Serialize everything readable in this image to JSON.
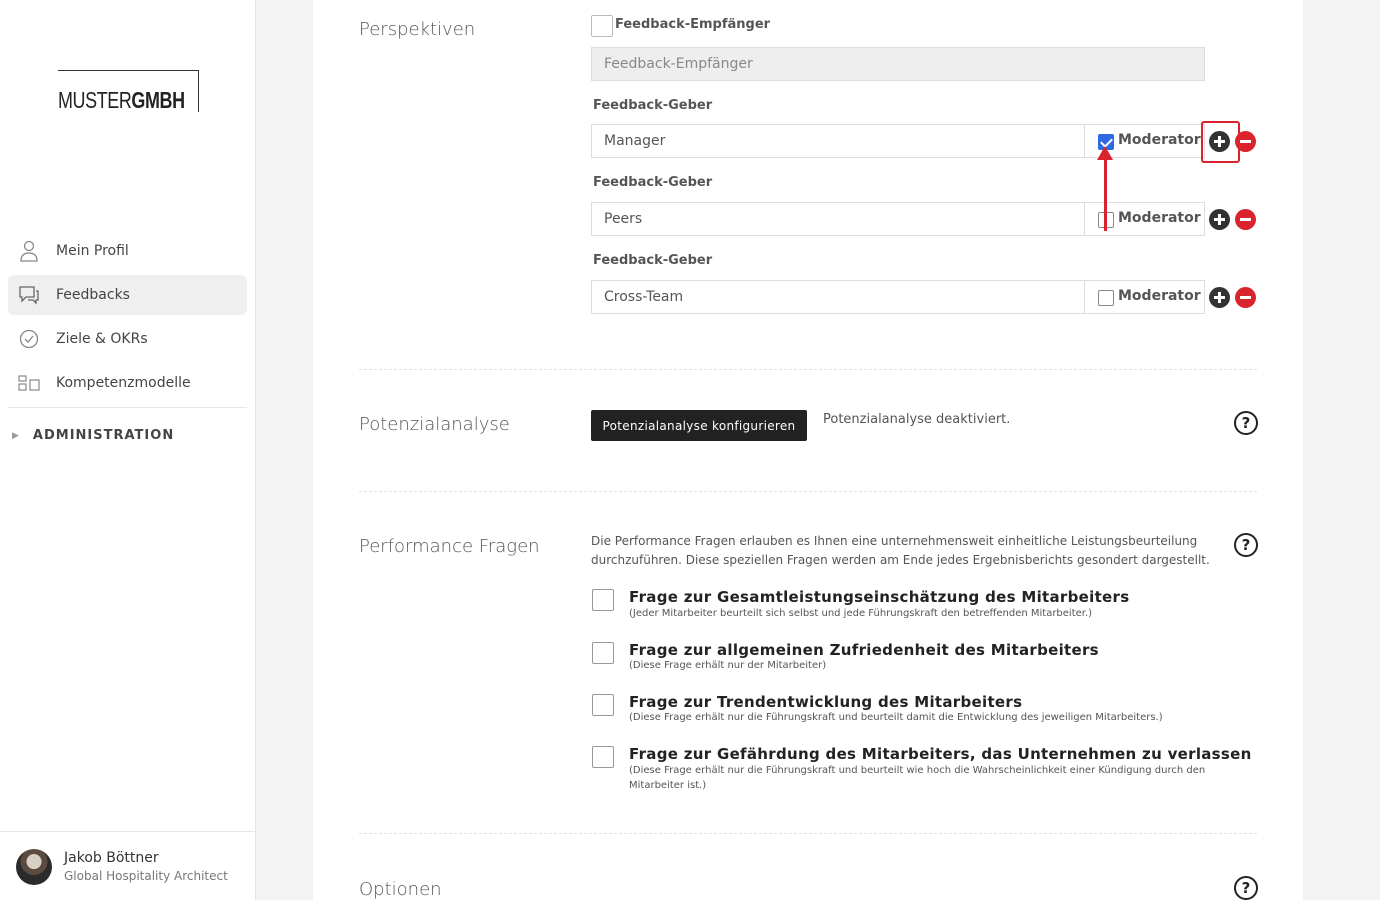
{
  "logo": {
    "part1": "MUSTER",
    "part2": "GMBH"
  },
  "nav": {
    "items": [
      {
        "label": "Mein Profil",
        "icon": "user-icon"
      },
      {
        "label": "Feedbacks",
        "icon": "chat-icon",
        "active": true
      },
      {
        "label": "Ziele & OKRs",
        "icon": "check-circle-icon"
      },
      {
        "label": "Kompetenzmodelle",
        "icon": "blocks-icon"
      }
    ],
    "admin_label": "ADMINISTRATION"
  },
  "user": {
    "name": "Jakob Böttner",
    "role": "Global Hospitality Architect"
  },
  "perspektiven": {
    "title": "Perspektiven",
    "empfaenger_label": "Feedback-Empfänger",
    "empfaenger_value": "Feedback-Empfänger",
    "geber": [
      {
        "label": "Feedback-Geber",
        "value": "Manager",
        "moderator_label": "Moderator",
        "moderator_checked": true
      },
      {
        "label": "Feedback-Geber",
        "value": "Peers",
        "moderator_label": "Moderator",
        "moderator_checked": false
      },
      {
        "label": "Feedback-Geber",
        "value": "Cross-Team",
        "moderator_label": "Moderator",
        "moderator_checked": false
      }
    ]
  },
  "potenzialanalyse": {
    "title": "Potenzialanalyse",
    "button_label": "Potenzialanalyse konfigurieren",
    "status": "Potenzialanalyse deaktiviert."
  },
  "performance": {
    "title": "Performance Fragen",
    "description": "Die Performance Fragen erlauben es Ihnen eine unternehmensweit einheitliche Leistungsbeurteilung durchzuführen. Diese speziellen Fragen werden am Ende jedes Ergebnisberichts gesondert dargestellt.",
    "questions": [
      {
        "title": "Frage zur Gesamtleistungseinschätzung des Mitarbeiters",
        "sub": "(Jeder Mitarbeiter beurteilt sich selbst und jede Führungskraft den betreffenden Mitarbeiter.)"
      },
      {
        "title": "Frage zur allgemeinen Zufriedenheit des Mitarbeiters",
        "sub": "(Diese Frage erhält nur der Mitarbeiter)"
      },
      {
        "title": "Frage zur Trendentwicklung des Mitarbeiters",
        "sub": "(Diese Frage erhält nur die Führungskraft und beurteilt damit die Entwicklung des jeweiligen Mitarbeiters.)"
      },
      {
        "title": "Frage zur Gefährdung des Mitarbeiters, das Unternehmen zu verlassen",
        "sub": "(Diese Frage erhält nur die Führungskraft und beurteilt wie hoch die Wahrscheinlichkeit einer Kündigung durch den Mitarbeiter ist.)"
      }
    ]
  },
  "optionen": {
    "title": "Optionen"
  },
  "help_glyph": "?",
  "colors": {
    "accent_red": "#d9232d",
    "checkbox_blue": "#2d6ae3",
    "dark_button": "#222222"
  }
}
